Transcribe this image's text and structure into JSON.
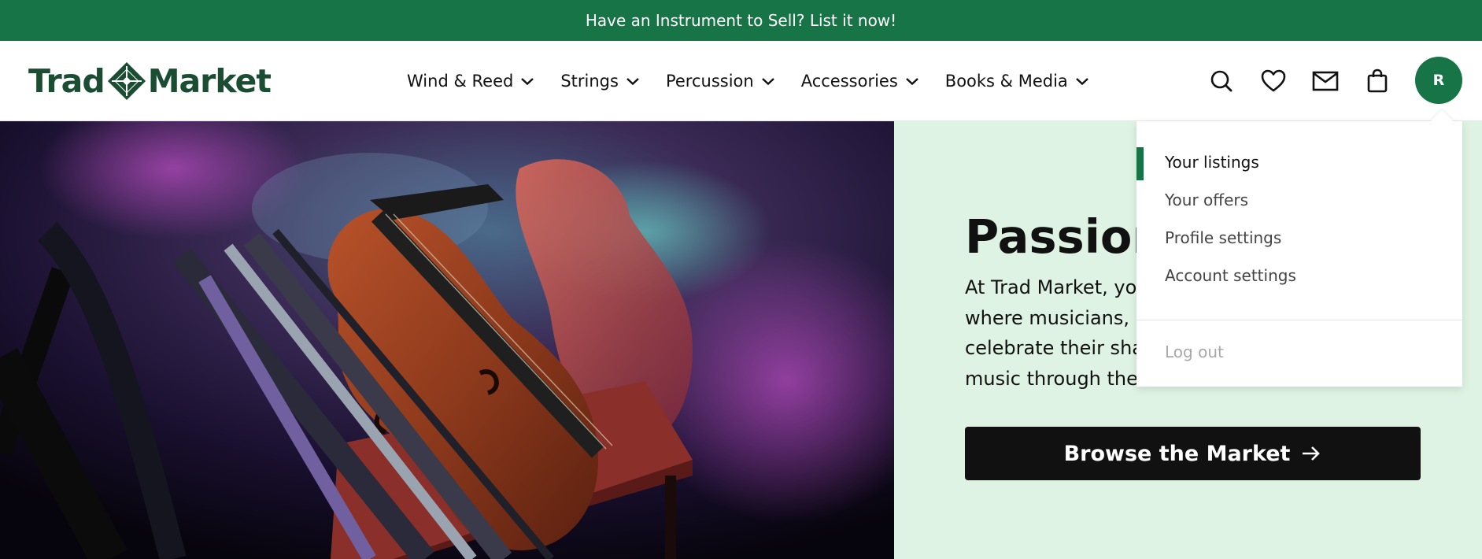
{
  "announcement": {
    "text": "Have an Instrument to Sell? List it now!"
  },
  "brand": {
    "logo_left": "Trad",
    "logo_right": "Market",
    "color": "#1b4d33",
    "accent": "#177446"
  },
  "nav": {
    "items": [
      {
        "label": "Wind & Reed"
      },
      {
        "label": "Strings"
      },
      {
        "label": "Percussion"
      },
      {
        "label": "Accessories"
      },
      {
        "label": "Books & Media"
      }
    ]
  },
  "header_icons": [
    "search-icon",
    "heart-icon",
    "mail-icon",
    "shopping-bag-icon"
  ],
  "user": {
    "avatar_initial": "R"
  },
  "user_menu": {
    "items": [
      {
        "label": "Your listings",
        "active": true
      },
      {
        "label": "Your offers"
      },
      {
        "label": "Profile settings"
      },
      {
        "label": "Account settings"
      }
    ],
    "logout_label": "Log out"
  },
  "hero": {
    "title": "Passion",
    "text": "At Trad Market, you where musicians, m celebrate their shar music through the i",
    "text_lines": [
      "At Trad Market, you",
      "where musicians, m",
      "celebrate their shar",
      "music through the i"
    ],
    "button_label": "Browse the Market",
    "background": "#def3e3"
  }
}
